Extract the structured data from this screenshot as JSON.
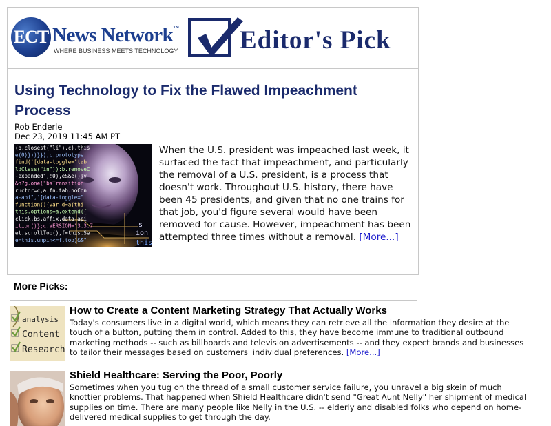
{
  "banner": {
    "logo_text": "ECT",
    "brand_name": "News Network",
    "trademark": "™",
    "tagline": "WHERE BUSINESS MEETS TECHNOLOGY",
    "section_title": "Editor's Pick"
  },
  "featured": {
    "headline": "Using Technology to Fix the Flawed Impeachment Process",
    "author": "Rob Enderle",
    "date": "Dec 23, 2019 11:45 AM PT",
    "summary": "When the U.S. president was impeached last week, it surfaced the fact that impeachment, and particularly the removal of a U.S. president, is a process that doesn't work. Throughout U.S. history, there have been 45 presidents, and given that no one trains for that job, you'd figure several would have been removed for cause. However, impeachment has been attempted three times without a removal.",
    "more_label": "[More...]",
    "image_code_lines": [
      "(b.closest(\"li\"),c),this",
      "e(0)}))}}),c.prototype",
      "find('[data-toggle=\"tab",
      "ldClass(\"in\")):b.removeC",
      "-expanded\",!0),e&&e()}v",
      "&h?g.one(\"bsTransition",
      "ructor=c,a.fn.tab.noCon",
      "a-api\",'[data-toggle=\"",
      "function(){var d=a(thi",
      "this.options=a.extend({",
      "click.bs.affix.data-api",
      "ition()};c.VERSION=\"3.3.7",
      "et.scrollTop(),f=this.Se",
      "e=this.unpin<=f.top)&&\""
    ]
  },
  "more_picks": {
    "label": "More Picks:",
    "items": [
      {
        "title": "How to Create a Content Marketing Strategy That Actually Works",
        "body": "Today's consumers live in a digital world, which means they can retrieve all the information they desire at the touch of a button, putting them in control. Added to this, they have become immune to traditional outbound marketing methods -- such as billboards and television advertisements -- and they expect brands and businesses to tailor their messages based on customers' individual preferences.",
        "more_label": "[More...]",
        "thumb_words": [
          "analysis",
          "Content",
          "Research"
        ]
      },
      {
        "title": "Shield Healthcare: Serving the Poor, Poorly",
        "body": "Sometimes when you tug on the thread of a small customer service failure, you unravel a big skein of much knottier problems. That happened when Shield Healthcare didn't send \"Great Aunt Nelly\" her shipment of medical supplies on time. There are many people like Nelly in the U.S. -- elderly and disabled folks who depend on home-delivered medical supplies to get through the day.",
        "more_label": "",
        "thumb_words": []
      }
    ]
  },
  "colors": {
    "brand_navy": "#1a2a6c",
    "link_blue": "#1a1acc",
    "border_gray": "#c8c8c8"
  }
}
